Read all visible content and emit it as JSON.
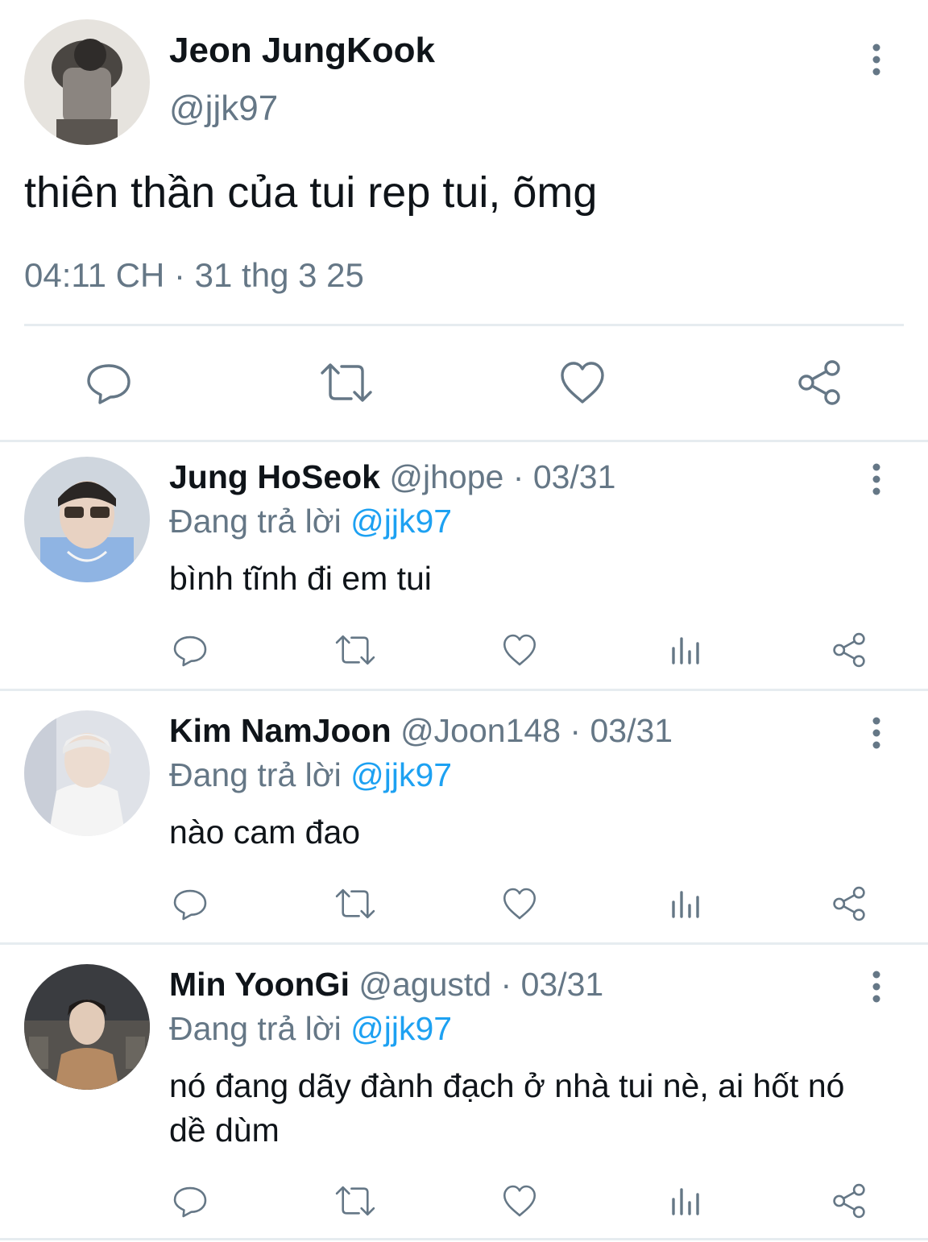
{
  "main_tweet": {
    "name": "Jeon JungKook",
    "handle": "@jjk97",
    "text": "thiên thần của tui rep tui, õmg",
    "time": "04:11 CH",
    "separator": "·",
    "date": "31 thg 3 25",
    "actions": [
      "reply-icon",
      "retweet-icon",
      "like-icon",
      "share-icon"
    ]
  },
  "replies": [
    {
      "name": "Jung HoSeok",
      "handle": "@jhope",
      "sep": "·",
      "date": "03/31",
      "replying_prefix": "Đang trả lời",
      "replying_handle": "@jjk97",
      "text": "bình tĩnh đi em tui"
    },
    {
      "name": "Kim NamJoon",
      "handle": "@Joon148",
      "sep": "·",
      "date": "03/31",
      "replying_prefix": "Đang trả lời",
      "replying_handle": "@jjk97",
      "text": "nào cam đao"
    },
    {
      "name": "Min YoonGi",
      "handle": "@agustd",
      "sep": "·",
      "date": "03/31",
      "replying_prefix": "Đang trả lời",
      "replying_handle": "@jjk97",
      "text": "nó đang dãy đành đạch ở nhà tui nè, ai hốt nó dề dùm"
    }
  ],
  "colors": {
    "text": "#0f1419",
    "muted": "#657786",
    "link": "#1da1f2",
    "divider": "#e6ecf0"
  }
}
